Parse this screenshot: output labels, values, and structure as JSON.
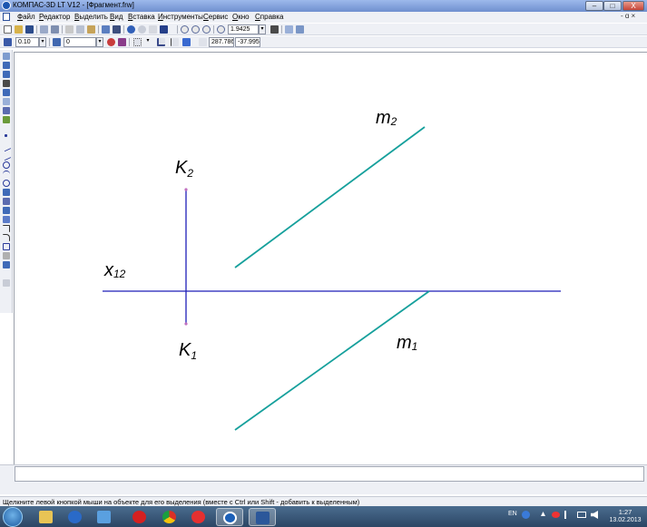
{
  "window": {
    "title": "КОМПАС-3D LT V12 - [Фрагмент.frw]",
    "minimize": "–",
    "maximize": "□",
    "close": "X",
    "doc_controls": "- ɑ ×"
  },
  "menu": {
    "items": [
      "Файл",
      "Редактор",
      "Выделить",
      "Вид",
      "Вставка",
      "Инструменты",
      "Сервис",
      "Окно",
      "Справка"
    ]
  },
  "toolbar_main": {
    "zoom_value": "1.9425"
  },
  "toolbar_props": {
    "step_value": "0.10",
    "layer_value": "0",
    "coord_x": "287.786",
    "coord_y": "-37.995"
  },
  "drawing": {
    "labels": {
      "k2_main": "K",
      "k2_sub": "2",
      "k1_main": "K",
      "k1_sub": "1",
      "x12_main": "x",
      "x12_sub": "12",
      "m2_main": "m",
      "m2_sub": "2",
      "m1_main": "m",
      "m1_sub": "1"
    },
    "colors": {
      "axis": "#1f1fb8",
      "line_m": "#16a09c",
      "point": "#c070c0"
    }
  },
  "status": {
    "text": "Щелкните левой кнопкой мыши на объекте для его выделения (вместе с Ctrl или Shift - добавить к выделенным)"
  },
  "taskbar": {
    "lang": "EN",
    "time": "1:27",
    "date": "13.02.2013"
  }
}
